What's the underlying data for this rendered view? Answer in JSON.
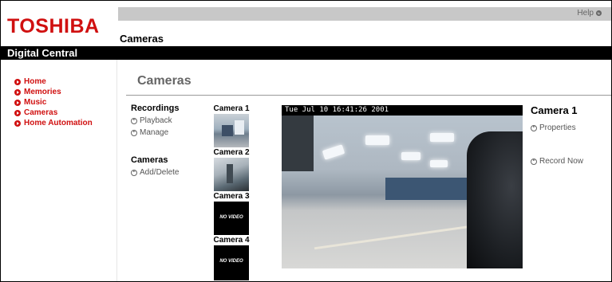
{
  "brand": {
    "logo_text": "TOSHIBA",
    "subtitle": "Digital Central"
  },
  "header": {
    "help_label": "Help",
    "page_title": "Cameras"
  },
  "nav": [
    {
      "label": "Home",
      "icon": "arrow-circle-icon"
    },
    {
      "label": "Memories",
      "icon": "arrow-circle-icon"
    },
    {
      "label": "Music",
      "icon": "arrow-circle-icon"
    },
    {
      "label": "Cameras",
      "icon": "arrow-circle-icon"
    },
    {
      "label": "Home Automation",
      "icon": "arrow-circle-icon"
    }
  ],
  "main": {
    "title": "Cameras",
    "recordings": {
      "heading": "Recordings",
      "links": [
        "Playback",
        "Manage"
      ]
    },
    "cameras_section": {
      "heading": "Cameras",
      "links": [
        "Add/Delete"
      ]
    },
    "camera_list": [
      {
        "label": "Camera 1",
        "feed": "live"
      },
      {
        "label": "Camera 2",
        "feed": "live"
      },
      {
        "label": "Camera 3",
        "feed": "none",
        "overlay": "NO VIDEO"
      },
      {
        "label": "Camera 4",
        "feed": "none",
        "overlay": "NO VIDEO"
      }
    ],
    "video": {
      "timestamp": "Tue Jul 10 16:41:26 2001"
    },
    "selected_camera": {
      "title": "Camera 1",
      "links": [
        "Properties",
        "Record Now"
      ]
    }
  },
  "colors": {
    "accent": "#d01010",
    "header_strip": "#c8c8c8",
    "bar": "#000000"
  }
}
